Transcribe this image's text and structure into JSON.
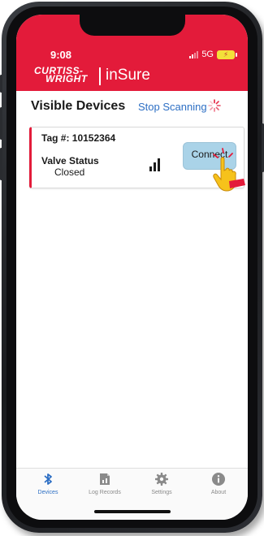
{
  "status_bar": {
    "time": "9:08",
    "network": "5G"
  },
  "header": {
    "logo_line1": "CURTISS-",
    "logo_line2": "WRIGHT",
    "brand": "inSure"
  },
  "page": {
    "title": "Visible Devices",
    "stop_scanning": "Stop Scanning"
  },
  "device": {
    "tag_label": "Tag #:  10152364",
    "valve_status_label": "Valve Status",
    "valve_status_value": "Closed",
    "connect_label": "Connect",
    "signal_bars": 3
  },
  "tabs": [
    {
      "label": "Devices",
      "icon": "bluetooth-icon",
      "active": true
    },
    {
      "label": "Log Records",
      "icon": "document-icon",
      "active": false
    },
    {
      "label": "Settings",
      "icon": "gear-icon",
      "active": false
    },
    {
      "label": "About",
      "icon": "info-icon",
      "active": false
    }
  ],
  "colors": {
    "brand_red": "#e31b3a",
    "link_blue": "#2d6fc4",
    "connect_bg": "#aad3e8"
  }
}
